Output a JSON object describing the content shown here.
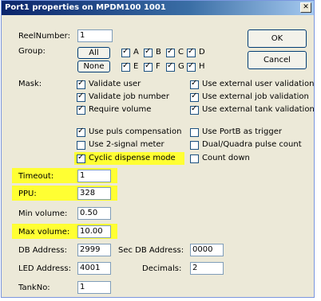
{
  "window": {
    "title": "Port1 properties on MPDM100 1001",
    "close_glyph": "✕"
  },
  "fields": {
    "reel_number": {
      "label": "ReelNumber:",
      "value": "1"
    },
    "timeout": {
      "label": "Timeout:",
      "value": "1"
    },
    "ppu": {
      "label": "PPU:",
      "value": "328"
    },
    "min_volume": {
      "label": "Min volume:",
      "value": "0.50"
    },
    "max_volume": {
      "label": "Max volume:",
      "value": "10.00"
    },
    "db_address": {
      "label": "DB Address:",
      "value": "2999"
    },
    "sec_db_address": {
      "label": "Sec DB Address:",
      "value": "0000"
    },
    "led_address": {
      "label": "LED Address:",
      "value": "4001"
    },
    "decimals": {
      "label": "Decimals:",
      "value": "2"
    },
    "tank_no": {
      "label": "TankNo:",
      "value": "1"
    }
  },
  "buttons": {
    "ok": "OK",
    "cancel": "Cancel",
    "all": "All",
    "none": "None"
  },
  "group": {
    "label": "Group:",
    "row1": [
      {
        "label": "A",
        "checked": true
      },
      {
        "label": "B",
        "checked": true
      },
      {
        "label": "C",
        "checked": true
      },
      {
        "label": "D",
        "checked": false
      }
    ],
    "row2": [
      {
        "label": "E",
        "checked": true
      },
      {
        "label": "F",
        "checked": true
      },
      {
        "label": "G",
        "checked": true
      },
      {
        "label": "H",
        "checked": false
      }
    ]
  },
  "mask": {
    "label": "Mask:",
    "left": [
      {
        "label": "Validate user",
        "checked": true
      },
      {
        "label": "Validate job number",
        "checked": true
      },
      {
        "label": "Require volume",
        "checked": true
      },
      {
        "label": "Use puls compensation",
        "checked": true
      },
      {
        "label": "Use 2-signal meter",
        "checked": false
      },
      {
        "label": "Cyclic dispense mode",
        "checked": true
      }
    ],
    "right": [
      {
        "label": "Use external user validation",
        "checked": true
      },
      {
        "label": "Use external job validation",
        "checked": true
      },
      {
        "label": "Use external tank validation",
        "checked": true
      },
      {
        "label": "Use PortB as trigger",
        "checked": false
      },
      {
        "label": "Dual/Quadra pulse count",
        "checked": false
      },
      {
        "label": "Count down",
        "checked": false
      }
    ]
  },
  "colors": {
    "highlight": "#ffff33",
    "title_bar": "#0a246a",
    "dialog_bg": "#ece9d8"
  }
}
